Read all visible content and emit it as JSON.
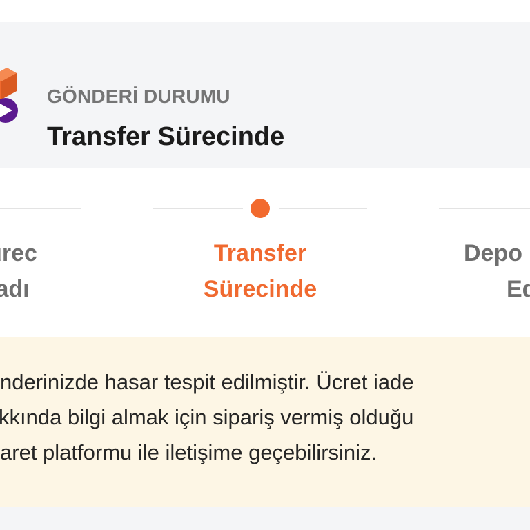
{
  "shipment_status": {
    "label": "GÖNDERİ DURUMU",
    "value": "Transfer Sürecinde",
    "icon": "package-delivery-icon",
    "colors": {
      "orange": "#f26a2e",
      "purple": "#5b1a8f"
    }
  },
  "steps": [
    {
      "line1": "ürec",
      "line2": "adı",
      "state": "completed"
    },
    {
      "line1": "Transfer",
      "line2": "Sürecinde",
      "state": "active"
    },
    {
      "line1": "Depo",
      "line2": "Ed",
      "state": "pending"
    }
  ],
  "notice": {
    "lines": [
      "nderinizde hasar tespit edilmiştir. Ücret iade",
      "kkında bilgi almak için sipariş vermiş olduğu",
      "aret platformu ile iletişime geçebilirsiniz."
    ],
    "background": "#fdf6e5"
  }
}
